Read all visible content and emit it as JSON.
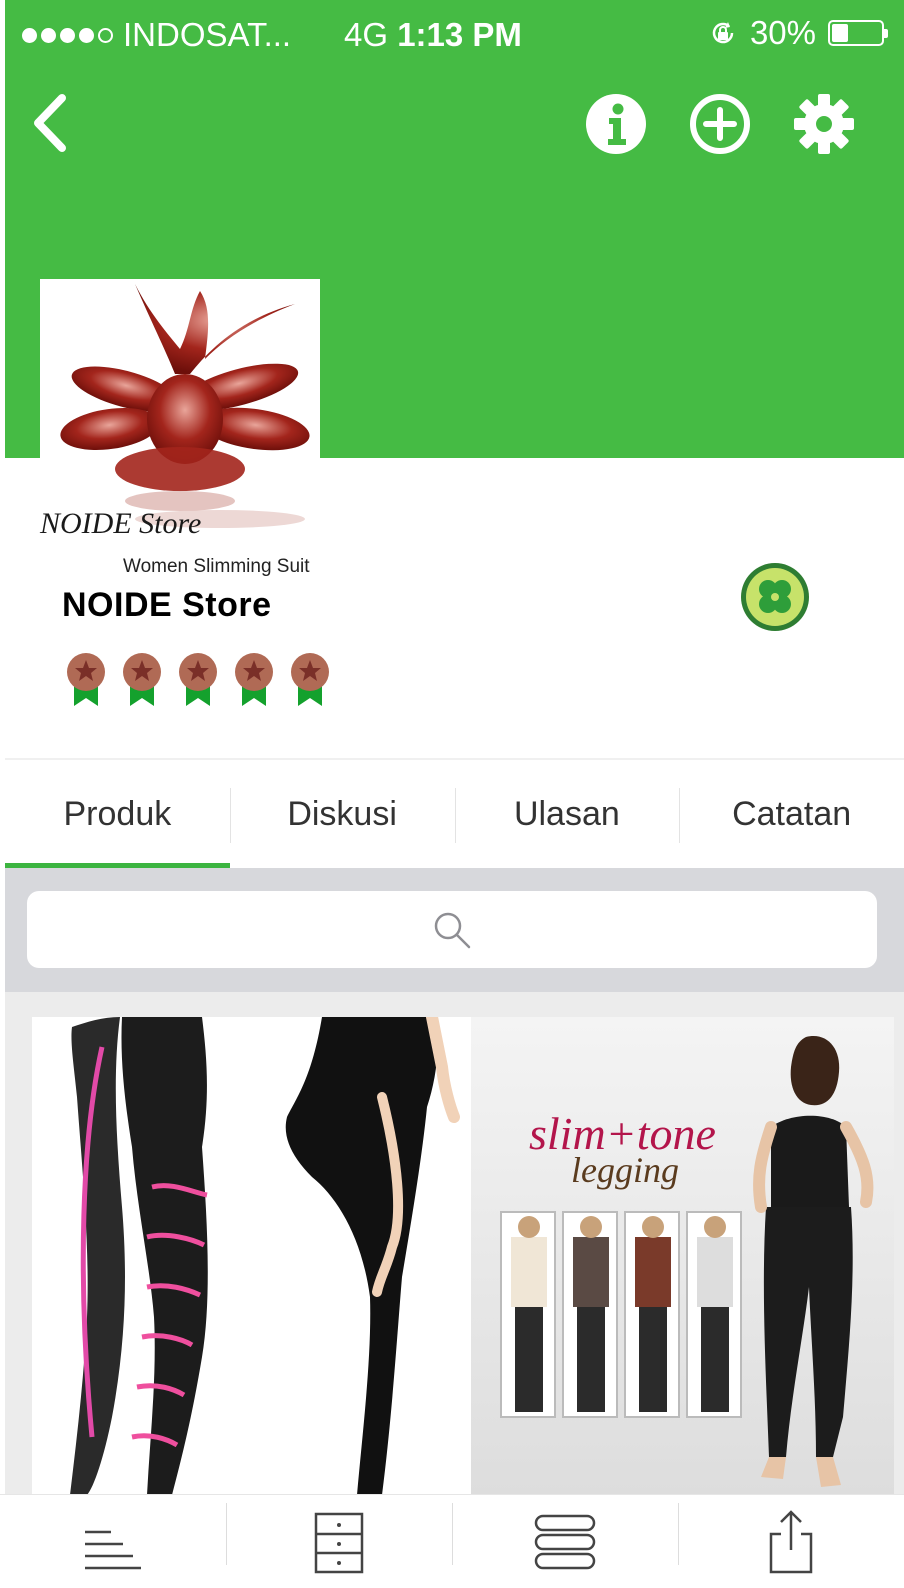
{
  "status_bar": {
    "carrier": "INDOSAT...",
    "network": "4G",
    "time": "1:13 PM",
    "battery": "30%",
    "signal_bars_filled": 4,
    "signal_bars_total": 5
  },
  "header": {
    "back_icon": "chevron-left-icon",
    "actions": [
      "info-icon",
      "plus-circle-icon",
      "gear-icon"
    ],
    "color": "#45bb44"
  },
  "store": {
    "logo_title": "NOIDE Store",
    "logo_subtitle": "Women Slimming Suit",
    "name": "NOIDE Store",
    "rating_medals": 5,
    "badge_icon": "gold-merchant-clover-icon"
  },
  "tabs": [
    {
      "label": "Produk",
      "active": true
    },
    {
      "label": "Diskusi",
      "active": false
    },
    {
      "label": "Ulasan",
      "active": false
    },
    {
      "label": "Catatan",
      "active": false
    }
  ],
  "search": {
    "placeholder": "",
    "icon": "search-icon"
  },
  "products": [
    {
      "image": "slimming-legging-photo",
      "text": ""
    },
    {
      "image": "slim-tone-legging-photo",
      "text_line1": "slim+tone",
      "text_line2": "legging"
    }
  ],
  "toolbar": {
    "icons": [
      "sort-icon",
      "drawer-icon",
      "list-view-icon",
      "share-icon"
    ]
  },
  "colors": {
    "accent": "#45bb44",
    "tab_indicator": "#3cb440",
    "medal": "#b06a55"
  }
}
